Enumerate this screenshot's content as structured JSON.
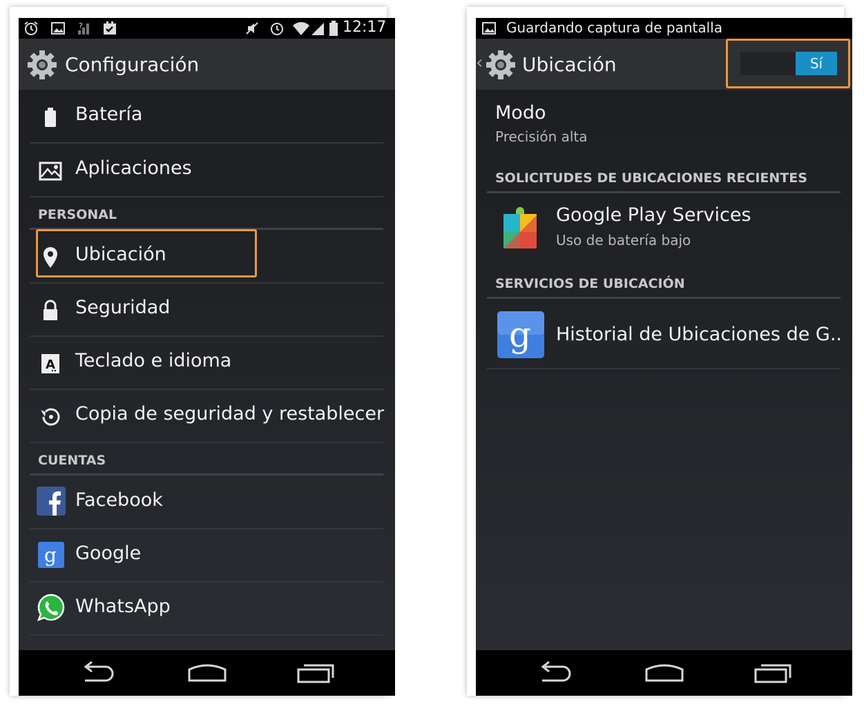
{
  "left": {
    "status_time": "12:17",
    "title": "Configuración",
    "items_top": [
      "Batería",
      "Aplicaciones"
    ],
    "section_personal": "PERSONAL",
    "items_personal": [
      "Ubicación",
      "Seguridad",
      "Teclado e idioma",
      "Copia de seguridad y restablecer"
    ],
    "section_accounts": "CUENTAS",
    "items_accounts": [
      "Facebook",
      "Google",
      "WhatsApp"
    ]
  },
  "right": {
    "notification_text": "Guardando captura de pantalla",
    "title": "Ubicación",
    "toggle_label": "Sí",
    "mode_title": "Modo",
    "mode_value": "Precisión alta",
    "section_recent": "SOLICITUDES DE UBICACIONES RECIENTES",
    "app_name": "Google Play Services",
    "app_sub": "Uso de batería bajo",
    "section_services": "SERVICIOS DE UBICACIÓN",
    "service_name": "Historial de Ubicaciones de G.."
  },
  "colors": {
    "highlight": "#f0963c",
    "toggle_on": "#1a8fc4",
    "facebook": "#3b5998",
    "google": "#3f7fe0",
    "whatsapp": "#2ab540"
  }
}
